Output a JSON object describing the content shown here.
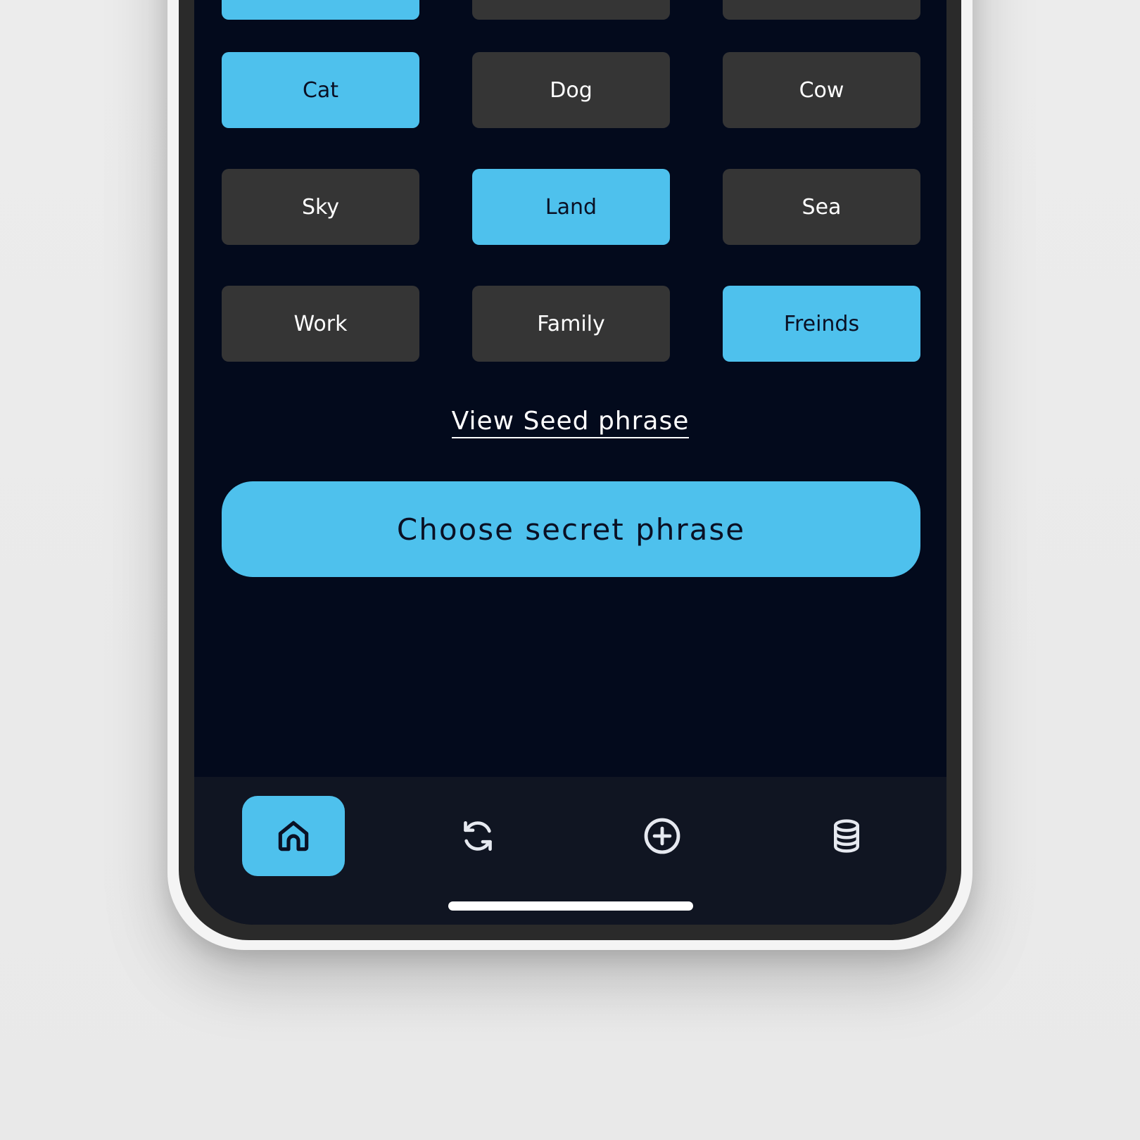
{
  "words": [
    {
      "label": "",
      "selected": true
    },
    {
      "label": "",
      "selected": false
    },
    {
      "label": "",
      "selected": false
    },
    {
      "label": "Cat",
      "selected": true
    },
    {
      "label": "Dog",
      "selected": false
    },
    {
      "label": "Cow",
      "selected": false
    },
    {
      "label": "Sky",
      "selected": false
    },
    {
      "label": "Land",
      "selected": true
    },
    {
      "label": "Sea",
      "selected": false
    },
    {
      "label": "Work",
      "selected": false
    },
    {
      "label": "Family",
      "selected": false
    },
    {
      "label": "Freinds",
      "selected": true
    }
  ],
  "view_link": "View Seed phrase",
  "cta_label": "Choose secret phrase",
  "tabbar": {
    "items": [
      {
        "icon": "home-icon",
        "active": true
      },
      {
        "icon": "refresh-icon",
        "active": false
      },
      {
        "icon": "add-circle-icon",
        "active": false
      },
      {
        "icon": "database-icon",
        "active": false
      }
    ]
  },
  "colors": {
    "accent": "#4ec1ed",
    "screen_bg": "#030a1c",
    "chip_bg": "#353535",
    "tabbar_bg": "#101522"
  }
}
